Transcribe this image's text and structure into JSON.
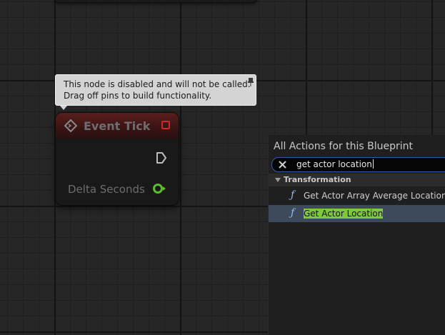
{
  "tooltip": {
    "line1": "This node is disabled and will not be called.",
    "line2": "Drag off pins to build functionality."
  },
  "node": {
    "title": "Event Tick",
    "output_label": "Delta Seconds",
    "colors": {
      "delegate_pin": "#cc2a2a",
      "float_pin": "#5bbd2f",
      "header": "#5a1d1d"
    }
  },
  "actions_panel": {
    "title": "All Actions for this Blueprint",
    "search_value": "get actor location",
    "category": "Transformation",
    "items": [
      {
        "icon": "ƒ",
        "label": "Get Actor Array Average Location",
        "selected": false
      },
      {
        "icon": "ƒ",
        "label": "Get Actor Location",
        "selected": true
      }
    ],
    "highlight_color": "#7ec73f",
    "selection_color": "#3d4a5c"
  }
}
